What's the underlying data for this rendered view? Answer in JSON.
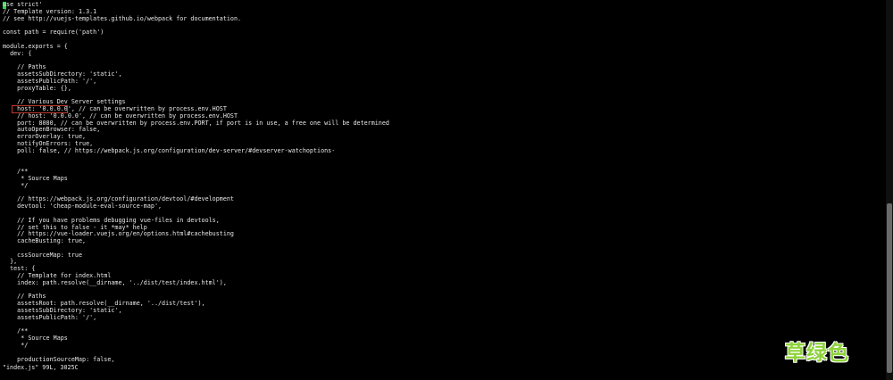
{
  "editor": {
    "lines": [
      "use strict'",
      "// Template version: 1.3.1",
      "// see http://vuejs-templates.github.io/webpack for documentation.",
      "",
      "const path = require('path')",
      "",
      "module.exports = {",
      "  dev: {",
      "",
      "    // Paths",
      "    assetsSubDirectory: 'static',",
      "    assetsPublicPath: '/',",
      "    proxyTable: {},",
      "",
      "    // Various Dev Server settings",
      "    host: '0.0.0.0', // can be overwritten by process.env.HOST",
      "    // host: '0.0.0.0', // can be overwritten by process.env.HOST",
      "    port: 8080, // can be overwritten by process.env.PORT, if port is in use, a free one will be determined",
      "    autoOpenBrowser: false,",
      "    errorOverlay: true,",
      "    notifyOnErrors: true,",
      "    poll: false, // https://webpack.js.org/configuration/dev-server/#devserver-watchoptions-",
      "",
      "",
      "    /**",
      "     * Source Maps",
      "     */",
      "",
      "    // https://webpack.js.org/configuration/devtool/#development",
      "    devtool: 'cheap-module-eval-source-map',",
      "",
      "    // If you have problems debugging vue-files in devtools,",
      "    // set this to false - it *may* help",
      "    // https://vue-loader.vuejs.org/en/options.html#cachebusting",
      "    cacheBusting: true,",
      "",
      "    cssSourceMap: true",
      "  },",
      "  test: {",
      "    // Template for index.html",
      "    index: path.resolve(__dirname, '../dist/test/index.html'),",
      "",
      "    // Paths",
      "    assetsRoot: path.resolve(__dirname, '../dist/test'),",
      "    assetsSubDirectory: 'static',",
      "    assetsPublicPath: '/',",
      "",
      "    /**",
      "     * Source Maps",
      "     */",
      "",
      "    productionSourceMap: false,"
    ],
    "status_line": "\"index.js\" 99L, 3025C",
    "watermark": "草绿色",
    "colors": {
      "background": "#000000",
      "text": "#e8e8e8",
      "cursor": "#2fd34a",
      "highlight_box": "#c0392b",
      "watermark": "#8ed23a"
    }
  }
}
